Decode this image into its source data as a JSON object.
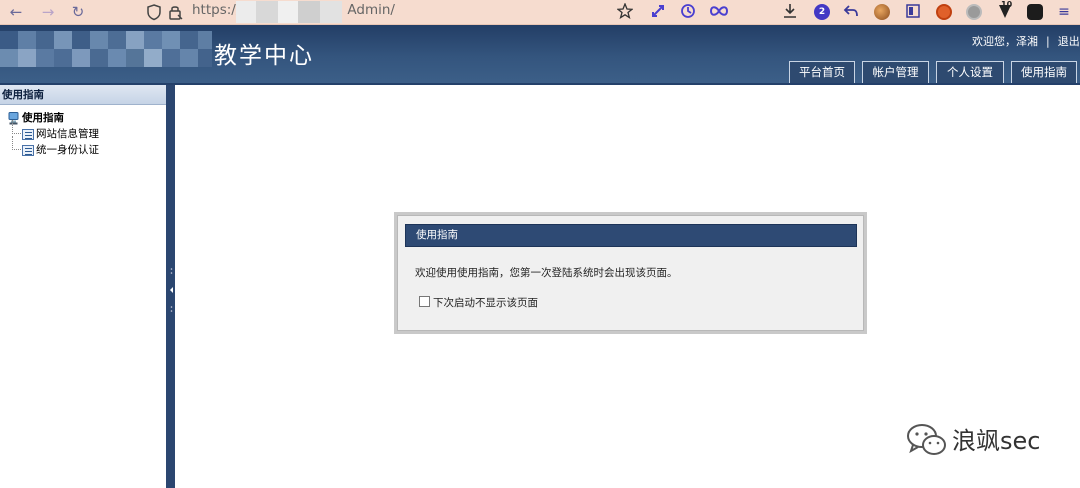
{
  "browser": {
    "url_prefix": "https://",
    "url_suffix": "Admin/",
    "download_badge": "2",
    "extension_badge": "10"
  },
  "header": {
    "title": "教学中心",
    "welcome": "欢迎您，泽湘",
    "separator": "|",
    "logout": "退出",
    "tabs": [
      {
        "label": "平台首页"
      },
      {
        "label": "帐户管理"
      },
      {
        "label": "个人设置"
      },
      {
        "label": "使用指南"
      }
    ]
  },
  "sidebar": {
    "heading": "使用指南",
    "root": "使用指南",
    "items": [
      {
        "label": "网站信息管理"
      },
      {
        "label": "统一身份认证"
      }
    ]
  },
  "dialog": {
    "title": "使用指南",
    "message": "欢迎使用使用指南，您第一次登陆系统时会出现该页面。",
    "checkbox_label": "下次启动不显示该页面",
    "checkbox_checked": false
  },
  "watermark": {
    "text": "浪飒sec"
  },
  "colors": {
    "header_bg": "#2c4a72",
    "browser_bg": "#f6dccf",
    "dialog_title_bg": "#2e4a74"
  }
}
